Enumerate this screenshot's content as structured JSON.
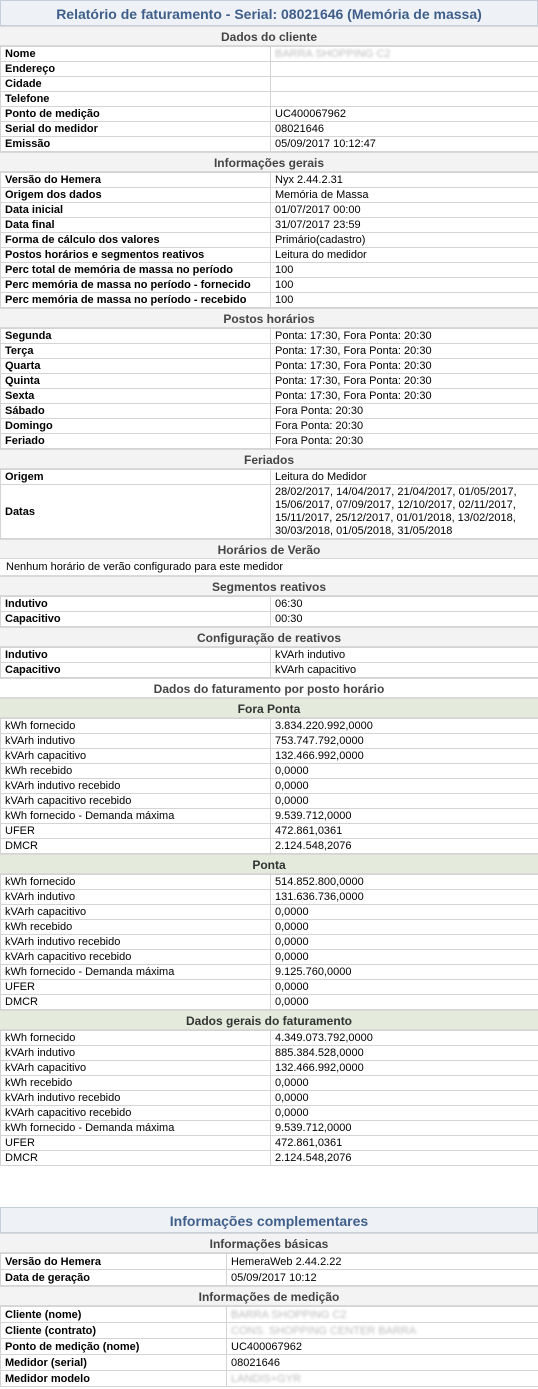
{
  "report": {
    "title": "Relatório de faturamento - Serial: 08021646 (Memória de massa)",
    "cliente": {
      "heading": "Dados do cliente",
      "rows": [
        {
          "k": "Nome",
          "v": "BARRA SHOPPING C2",
          "redacted": true
        },
        {
          "k": "Endereço",
          "v": ""
        },
        {
          "k": "Cidade",
          "v": ""
        },
        {
          "k": "Telefone",
          "v": ""
        },
        {
          "k": "Ponto de medição",
          "v": "UC400067962"
        },
        {
          "k": "Serial do medidor",
          "v": "08021646"
        },
        {
          "k": "Emissão",
          "v": "05/09/2017 10:12:47"
        }
      ]
    },
    "gerais": {
      "heading": "Informações gerais",
      "rows": [
        {
          "k": "Versão do Hemera",
          "v": "Nyx 2.44.2.31"
        },
        {
          "k": "Origem dos dados",
          "v": "Memória de Massa"
        },
        {
          "k": "Data inicial",
          "v": "01/07/2017 00:00"
        },
        {
          "k": "Data final",
          "v": "31/07/2017 23:59"
        },
        {
          "k": "Forma de cálculo dos valores",
          "v": "Primário(cadastro)"
        },
        {
          "k": "Postos horários e segmentos reativos",
          "v": "Leitura do medidor"
        },
        {
          "k": "Perc total de memória de massa no período",
          "v": "100"
        },
        {
          "k": "Perc memória de massa no período - fornecido",
          "v": "100"
        },
        {
          "k": "Perc memória de massa no período - recebido",
          "v": "100"
        }
      ]
    },
    "postos": {
      "heading": "Postos horários",
      "rows": [
        {
          "k": "Segunda",
          "v": "Ponta: 17:30, Fora Ponta: 20:30"
        },
        {
          "k": "Terça",
          "v": "Ponta: 17:30, Fora Ponta: 20:30"
        },
        {
          "k": "Quarta",
          "v": "Ponta: 17:30, Fora Ponta: 20:30"
        },
        {
          "k": "Quinta",
          "v": "Ponta: 17:30, Fora Ponta: 20:30"
        },
        {
          "k": "Sexta",
          "v": "Ponta: 17:30, Fora Ponta: 20:30"
        },
        {
          "k": "Sábado",
          "v": "Fora Ponta: 20:30"
        },
        {
          "k": "Domingo",
          "v": "Fora Ponta: 20:30"
        },
        {
          "k": "Feriado",
          "v": "Fora Ponta: 20:30"
        }
      ]
    },
    "feriados": {
      "heading": "Feriados",
      "origem_label": "Origem",
      "origem_value": "Leitura do Medidor",
      "datas_label": "Datas",
      "datas_value": "28/02/2017, 14/04/2017, 21/04/2017, 01/05/2017, 15/06/2017, 07/09/2017, 12/10/2017, 02/11/2017, 15/11/2017, 25/12/2017, 01/01/2018, 13/02/2018, 30/03/2018, 01/05/2018, 31/05/2018"
    },
    "verao": {
      "heading": "Horários de Verão",
      "text": "Nenhum horário de verão configurado para este medidor"
    },
    "segmentos": {
      "heading": "Segmentos reativos",
      "rows": [
        {
          "k": "Indutivo",
          "v": "06:30"
        },
        {
          "k": "Capacitivo",
          "v": "00:30"
        }
      ]
    },
    "config_reativos": {
      "heading": "Configuração de reativos",
      "rows": [
        {
          "k": "Indutivo",
          "v": "kVArh indutivo"
        },
        {
          "k": "Capacitivo",
          "v": "kVArh capacitivo"
        }
      ]
    },
    "faturamento_heading": "Dados do faturamento por posto horário",
    "fora_ponta": {
      "heading": "Fora Ponta",
      "rows": [
        {
          "k": "kWh fornecido",
          "v": "3.834.220.992,0000"
        },
        {
          "k": "kVArh indutivo",
          "v": "753.747.792,0000"
        },
        {
          "k": "kVArh capacitivo",
          "v": "132.466.992,0000"
        },
        {
          "k": "kWh recebido",
          "v": "0,0000"
        },
        {
          "k": "kVArh indutivo recebido",
          "v": "0,0000"
        },
        {
          "k": "kVArh capacitivo recebido",
          "v": "0,0000"
        },
        {
          "k": "kWh fornecido - Demanda máxima",
          "v": "9.539.712,0000"
        },
        {
          "k": "UFER",
          "v": "472.861,0361"
        },
        {
          "k": "DMCR",
          "v": "2.124.548,2076"
        }
      ]
    },
    "ponta": {
      "heading": "Ponta",
      "rows": [
        {
          "k": "kWh fornecido",
          "v": "514.852.800,0000"
        },
        {
          "k": "kVArh indutivo",
          "v": "131.636.736,0000"
        },
        {
          "k": "kVArh capacitivo",
          "v": "0,0000"
        },
        {
          "k": "kWh recebido",
          "v": "0,0000"
        },
        {
          "k": "kVArh indutivo recebido",
          "v": "0,0000"
        },
        {
          "k": "kVArh capacitivo recebido",
          "v": "0,0000"
        },
        {
          "k": "kWh fornecido - Demanda máxima",
          "v": "9.125.760,0000"
        },
        {
          "k": "UFER",
          "v": "0,0000"
        },
        {
          "k": "DMCR",
          "v": "0,0000"
        }
      ]
    },
    "dados_gerais": {
      "heading": "Dados gerais do faturamento",
      "rows": [
        {
          "k": "kWh fornecido",
          "v": "4.349.073.792,0000"
        },
        {
          "k": "kVArh indutivo",
          "v": "885.384.528,0000"
        },
        {
          "k": "kVArh capacitivo",
          "v": "132.466.992,0000"
        },
        {
          "k": "kWh recebido",
          "v": "0,0000"
        },
        {
          "k": "kVArh indutivo recebido",
          "v": "0,0000"
        },
        {
          "k": "kVArh capacitivo recebido",
          "v": "0,0000"
        },
        {
          "k": "kWh fornecido - Demanda máxima",
          "v": "9.539.712,0000"
        },
        {
          "k": "UFER",
          "v": "472.861,0361"
        },
        {
          "k": "DMCR",
          "v": "2.124.548,2076"
        }
      ]
    }
  },
  "complementary": {
    "title": "Informações complementares",
    "basicas": {
      "heading": "Informações básicas",
      "rows": [
        {
          "k": "Versão do Hemera",
          "v": "HemeraWeb 2.44.2.22"
        },
        {
          "k": "Data de geração",
          "v": "05/09/2017 10:12"
        }
      ]
    },
    "medicao": {
      "heading": "Informações de medição",
      "rows": [
        {
          "k": "Cliente (nome)",
          "v": "BARRA SHOPPING C2",
          "redacted": true
        },
        {
          "k": "Cliente (contrato)",
          "v": "CONS. SHOPPING CENTER BARRA",
          "redacted": true
        },
        {
          "k": "Ponto de medição (nome)",
          "v": "UC400067962"
        },
        {
          "k": "Medidor (serial)",
          "v": "08021646"
        },
        {
          "k": "Medidor modelo",
          "v": "LANDIS+GYR",
          "redacted": true
        }
      ]
    }
  }
}
